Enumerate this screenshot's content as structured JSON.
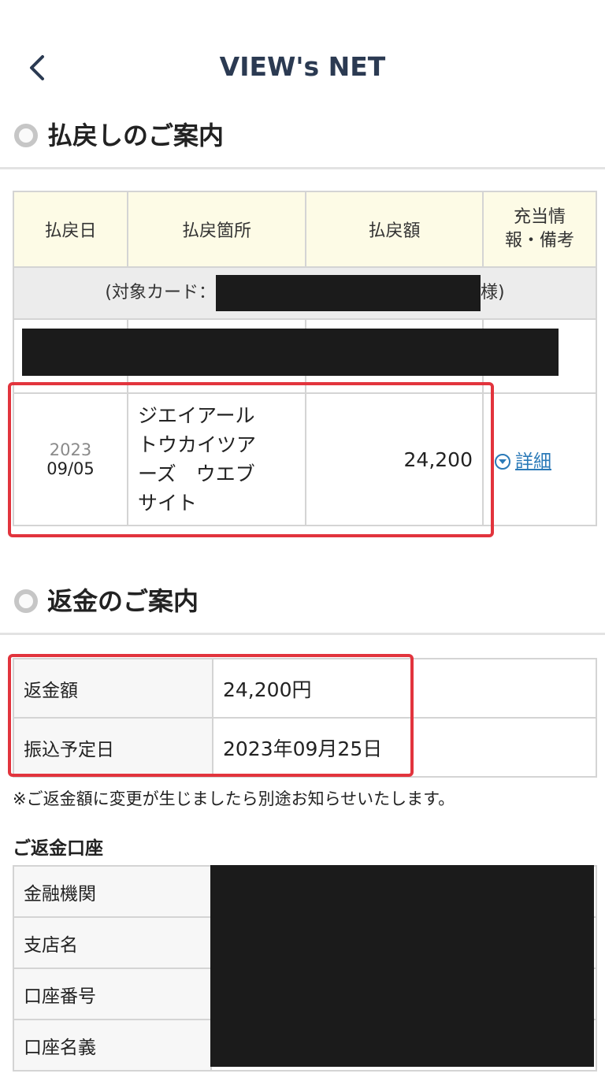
{
  "header": {
    "title": "VIEW's NET"
  },
  "refund_section": {
    "title": "払戻しのご案内",
    "table": {
      "headers": [
        "払戻日",
        "払戻箇所",
        "払戻額",
        "充当情\n報・備考"
      ],
      "card_prefix": "(対象カード：",
      "card_suffix": "様)",
      "row": {
        "year": "2023",
        "date": "09/05",
        "place": "ジエイアール\nトウカイツア\nーズ　ウエブ\nサイト",
        "amount": "24,200",
        "detail_label": "詳細"
      }
    }
  },
  "repay_section": {
    "title": "返金のご案内",
    "rows": [
      {
        "label": "返金額",
        "value": "24,200円"
      },
      {
        "label": "振込予定日",
        "value": "2023年09月25日"
      }
    ],
    "note": "※ご返金額に変更が生じましたら別途お知らせいたします。",
    "account_title": "ご返金口座",
    "account_rows": [
      "金融機関",
      "支店名",
      "口座番号",
      "口座名義"
    ]
  },
  "colors": {
    "title": "#2b3a52",
    "link": "#2b7ab8",
    "highlight": "#e2343d",
    "header_bg": "#fdfbe6",
    "mask": "#1b1b1b"
  }
}
